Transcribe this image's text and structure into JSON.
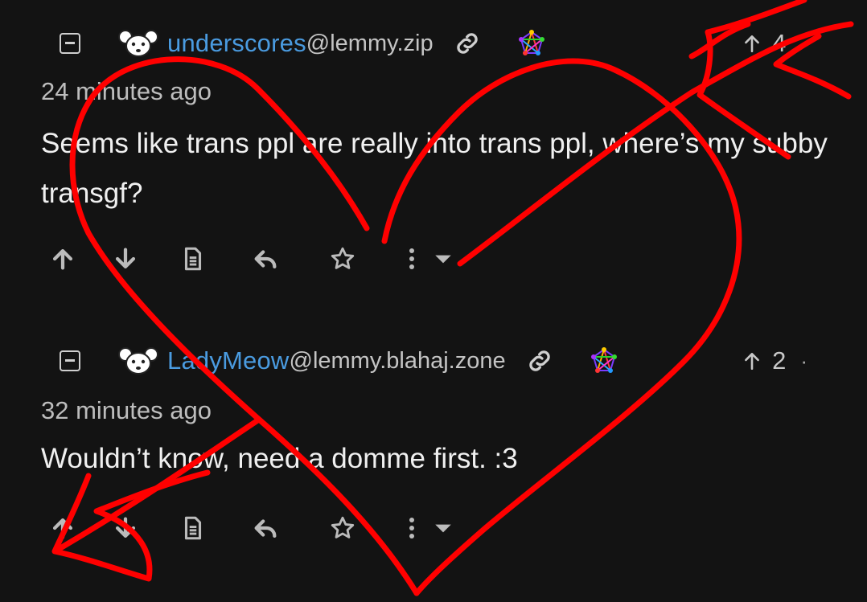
{
  "comments": [
    {
      "username": "underscores",
      "instance": "@lemmy.zip",
      "score": "4",
      "time": "24 minutes ago",
      "body": "Seems like trans ppl are really into trans ppl, where’s my subby transgf?"
    },
    {
      "username": "LadyMeow",
      "instance": "@lemmy.blahaj.zone",
      "score": "2",
      "time": "32 minutes ago",
      "body": "Wouldn’t know, need a domme first. :3"
    }
  ],
  "colors": {
    "background": "#131313",
    "username": "#4a9be0",
    "scribble": "#ff0000"
  },
  "icons": [
    "collapse-icon",
    "avatar-icon",
    "link-icon",
    "fediverse-icon",
    "upvote-icon",
    "downvote-icon",
    "view-source-icon",
    "reply-icon",
    "save-star-icon",
    "more-icon",
    "dropdown-icon"
  ]
}
